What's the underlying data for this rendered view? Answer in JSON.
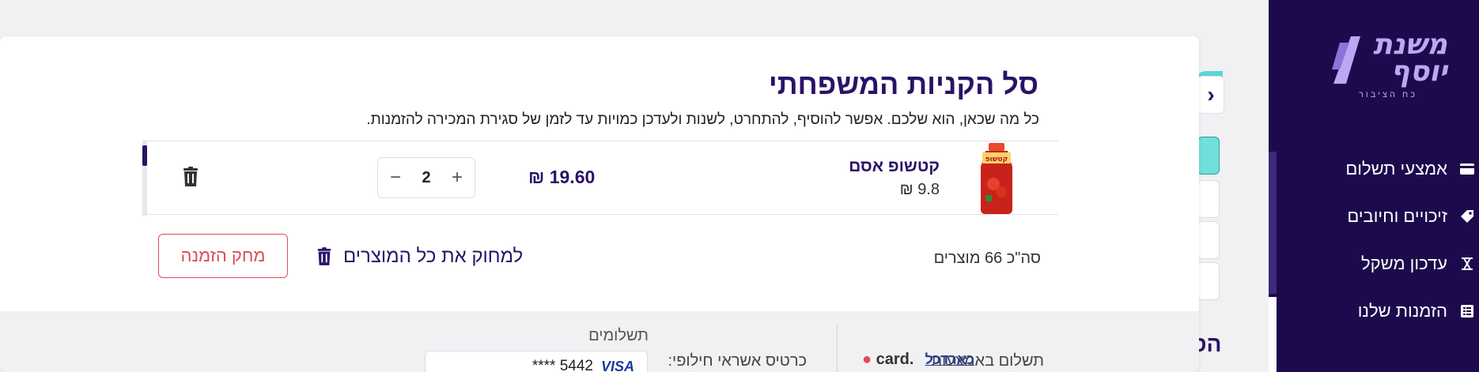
{
  "sidebar": {
    "logo_text": "משנת יוסף",
    "logo_tag": "כח הציבור",
    "items": [
      {
        "label": "אמצעי תשלום",
        "icon": "credit-card-icon"
      },
      {
        "label": "זיכויים וחיובים",
        "icon": "tag-icon"
      },
      {
        "label": "עדכון משקל",
        "icon": "scale-icon"
      },
      {
        "label": "הזמנות שלנו",
        "icon": "list-icon"
      }
    ]
  },
  "partial_heading": "הס",
  "cart": {
    "title": "סל הקניות המשפחתי",
    "subtitle": "כל מה שכאן, הוא שלכם. אפשר להוסיף, להתחרט, לשנות ולעדכן כמויות עד לזמן של סגירת המכירה להזמנות.",
    "items": [
      {
        "name": "קטשופ אסם",
        "unit_price": "9.8 ₪",
        "total": "19.60 ₪",
        "quantity": "2"
      }
    ],
    "count_text": "סה\"כ 66 מוצרים",
    "delete_all_label": "למחוק את כל המוצרים",
    "delete_order_label": "מחק הזמנה"
  },
  "footer": {
    "payments_label": "תשלומים",
    "pay_via_label": "תשלום באמצעות",
    "alt_card_label": "כרטיס אשראי חילופי:",
    "card_value": "**** 5442",
    "card_brand": "VISA",
    "logo_cal": "card.",
    "logo_kartcal": "כארדכל"
  },
  "colors": {
    "brand_purple": "#2a1267",
    "sidebar_bg": "#1d0a4d",
    "danger": "#e04a5a",
    "teal": "#59d8d1"
  }
}
